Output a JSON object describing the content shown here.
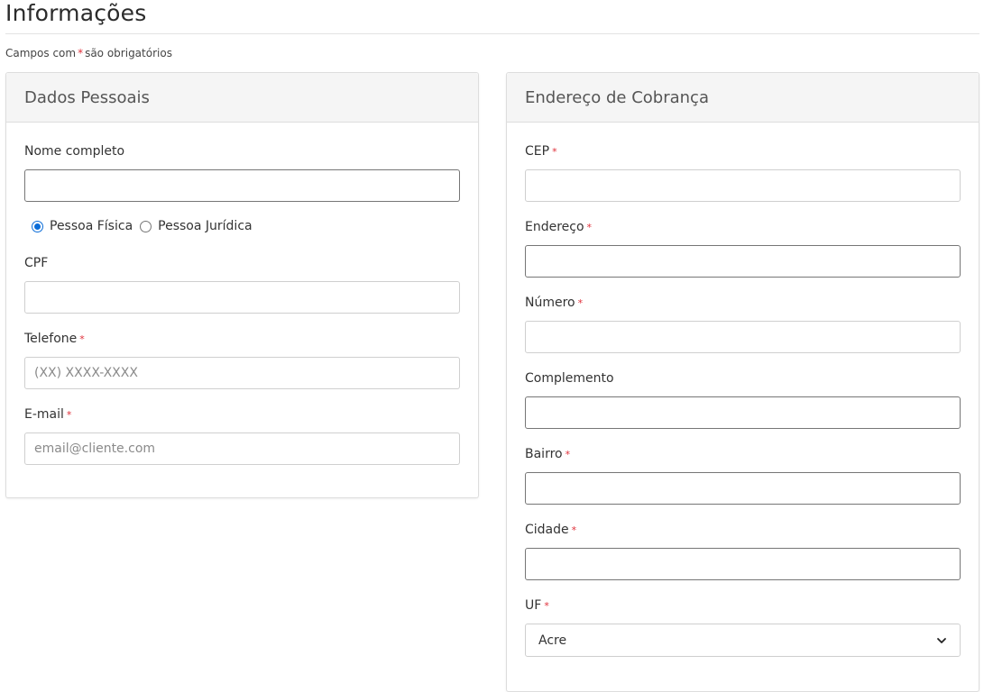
{
  "page": {
    "title": "Informações",
    "required_note_prefix": "Campos com",
    "required_note_asterisk": "*",
    "required_note_suffix": "são obrigatórios"
  },
  "personal": {
    "heading": "Dados Pessoais",
    "full_name_label": "Nome completo",
    "full_name_value": "",
    "person_type_options": [
      "Pessoa Física",
      "Pessoa Jurídica"
    ],
    "person_type_selected": "Pessoa Física",
    "cpf_label": "CPF",
    "cpf_value": "",
    "phone_label": "Telefone",
    "phone_placeholder": "(XX) XXXX-XXXX",
    "email_label": "E-mail",
    "email_placeholder": "email@cliente.com",
    "required_marker": "*"
  },
  "billing": {
    "heading": "Endereço de Cobrança",
    "cep_label": "CEP",
    "address_label": "Endereço",
    "number_label": "Número",
    "complement_label": "Complemento",
    "district_label": "Bairro",
    "city_label": "Cidade",
    "state_label": "UF",
    "state_selected": "Acre",
    "required_marker": "*"
  },
  "colors": {
    "required": "#e0303a",
    "radio_checked": "#0a6cd8",
    "panel_heading_bg": "#f5f5f5"
  },
  "icons": {
    "select_arrow": "chevron-down-icon"
  }
}
